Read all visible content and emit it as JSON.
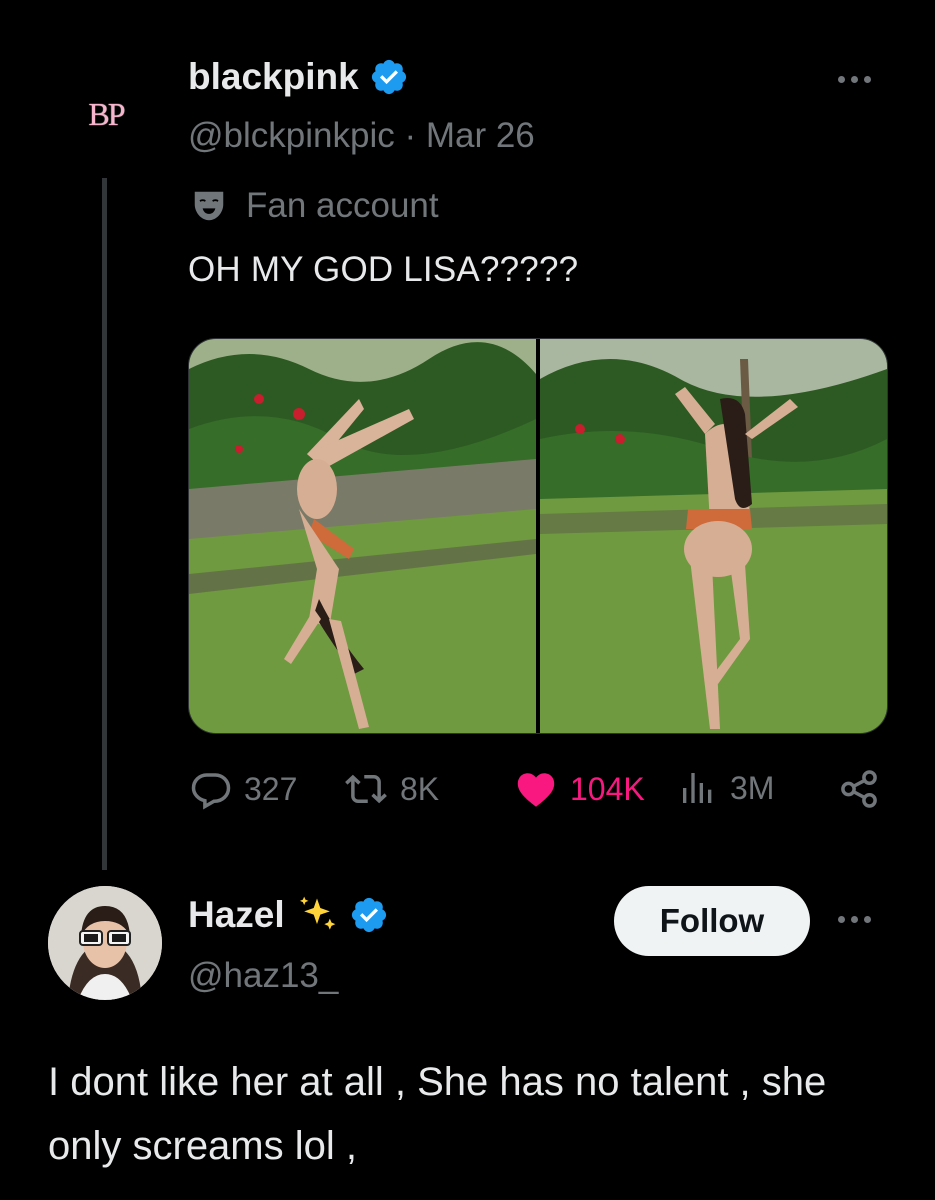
{
  "parent_tweet": {
    "avatar_text": "BP",
    "display_name": "blackpink",
    "handle": "@blckpinkpic",
    "separator": "·",
    "date": "Mar 26",
    "label_text": "Fan account",
    "text": "OH MY GOD LISA?????",
    "stats": {
      "replies": "327",
      "reposts": "8K",
      "likes": "104K",
      "views": "3M"
    }
  },
  "reply_tweet": {
    "display_name": "Hazel",
    "handle": "@haz13_",
    "follow_label": "Follow",
    "text": "I dont like her at all , She has no talent , she only screams lol ,"
  },
  "colors": {
    "background": "#000000",
    "text": "#e7e9ea",
    "muted": "#71767b",
    "verified": "#1d9bf0",
    "like": "#f91880",
    "avatar_text": "#f7b4cc",
    "sparkle": "#ffd43b"
  },
  "icons": [
    "verified-badge-icon",
    "more-icon",
    "fan-account-mask-icon",
    "reply-icon",
    "repost-icon",
    "heart-icon",
    "views-icon",
    "share-icon",
    "sparkles-icon"
  ]
}
